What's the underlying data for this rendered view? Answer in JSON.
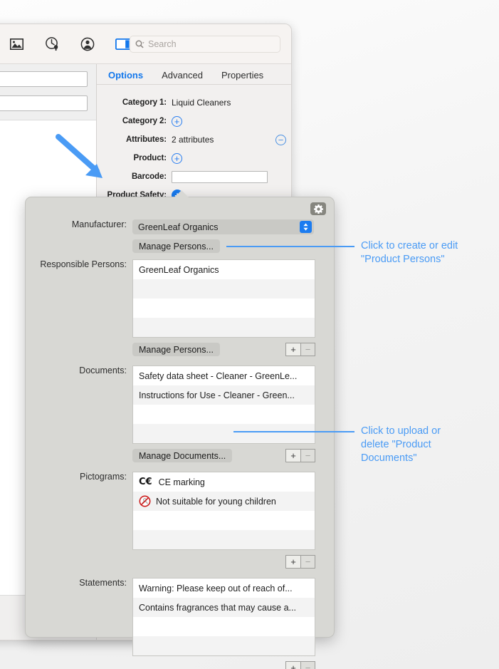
{
  "toolbar": {
    "icons": [
      {
        "name": "image-icon",
        "glyph": "image"
      },
      {
        "name": "reminder-clock-icon",
        "glyph": "clock-bell"
      },
      {
        "name": "account-person-icon",
        "glyph": "person"
      },
      {
        "name": "sidebar-toggle-icon",
        "glyph": "sidebar"
      }
    ],
    "search_placeholder": "Search",
    "search_value": ""
  },
  "tabs": [
    {
      "label": "Options",
      "active": true
    },
    {
      "label": "Advanced",
      "active": false
    },
    {
      "label": "Properties",
      "active": false
    }
  ],
  "form": {
    "category1": {
      "label": "Category 1:",
      "value": "Liquid Cleaners"
    },
    "category2": {
      "label": "Category 2:",
      "add_glyph": "+"
    },
    "attributes": {
      "label": "Attributes:",
      "value": "2 attributes",
      "remove_glyph": "−"
    },
    "product": {
      "label": "Product:",
      "add_glyph": "+"
    },
    "barcode": {
      "label": "Barcode:",
      "value": "",
      "placeholder": ""
    },
    "product_safety": {
      "label": "Product Safety:",
      "add_glyph": "+"
    }
  },
  "left_pane": {
    "minus_label": "−",
    "plus_label": ""
  },
  "popover": {
    "gear_icon": "gear-icon",
    "manufacturer": {
      "label": "Manufacturer:",
      "value": "GreenLeaf Organics"
    },
    "manage_persons_top": "Manage Persons...",
    "responsible_persons": {
      "label": "Responsible Persons:",
      "items": [
        "GreenLeaf Organics",
        "",
        "",
        ""
      ],
      "manage_button": "Manage Persons...",
      "add": "+",
      "remove": "−"
    },
    "documents": {
      "label": "Documents:",
      "items": [
        "Safety data sheet - Cleaner - GreenLe...",
        "Instructions for Use - Cleaner - Green...",
        "",
        ""
      ],
      "manage_button": "Manage Documents...",
      "add": "+",
      "remove": "−"
    },
    "pictograms": {
      "label": "Pictograms:",
      "items": [
        {
          "icon": "ce-marking-icon",
          "text": "CE marking"
        },
        {
          "icon": "no-young-children-icon",
          "text": "Not suitable for young children"
        },
        {
          "icon": "",
          "text": ""
        },
        {
          "icon": "",
          "text": ""
        }
      ],
      "add": "+",
      "remove": "−"
    },
    "statements": {
      "label": "Statements:",
      "items": [
        "Warning: Please keep out of reach of...",
        "Contains fragrances that may cause a...",
        "",
        ""
      ],
      "add": "+",
      "remove": "−"
    }
  },
  "annotations": [
    {
      "text": "Click to create or edit\n\"Product Persons\"",
      "line1": "Click to create or edit",
      "line2": "\"Product Persons\""
    },
    {
      "text": "Click to upload or delete \"Product Documents\"",
      "line1": "Click to upload or",
      "line2": "delete \"Product",
      "line3": "Documents\""
    }
  ],
  "colors": {
    "accent_blue": "#1277ec",
    "annotation_blue": "#4a9bf5",
    "popover_bg": "#d8d8d4",
    "window_bg": "#f2f0ef"
  }
}
